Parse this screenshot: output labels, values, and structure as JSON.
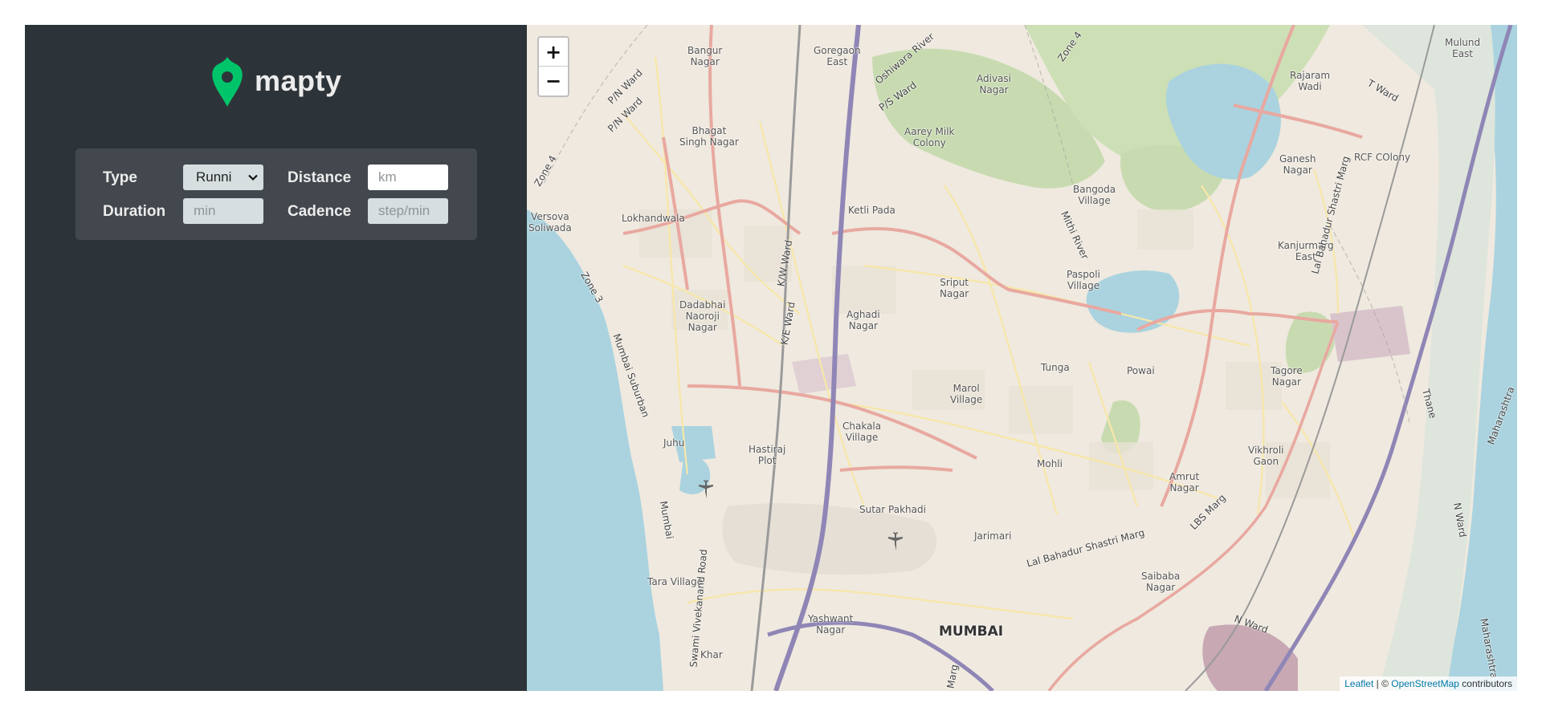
{
  "logo": {
    "text": "mapty",
    "icon": "map-pin-icon",
    "icon_color": "#00c46a"
  },
  "form": {
    "type_label": "Type",
    "type_value": "Runni",
    "distance_label": "Distance",
    "distance_placeholder": "km",
    "duration_label": "Duration",
    "duration_placeholder": "min",
    "cadence_label": "Cadence",
    "cadence_placeholder": "step/min"
  },
  "map": {
    "zoom_in": "+",
    "zoom_out": "−",
    "attribution": {
      "leaflet": "Leaflet",
      "separator": " | © ",
      "osm": "OpenStreetMap",
      "suffix": " contributors"
    },
    "places": [
      "Bangur\nNagar",
      "Goregaon\nEast",
      "Bhagat\nSingh Nagar",
      "Aarey Milk\nColony",
      "Adivasi\nNagar",
      "Rajaram\nWadi",
      "Mulund\nEast",
      "Ganesh\nNagar",
      "RCF COlony",
      "Bangoda\nVillage",
      "Ketli Pada",
      "Lokhandwala",
      "Versova\nSoliwada",
      "Sriput\nNagar",
      "Paspoli\nVillage",
      "Kanjurmarg\nEast",
      "Dadabhai\nNaoroji\nNagar",
      "Aghadi\nNagar",
      "Powai",
      "Tunga",
      "Tagore\nNagar",
      "Marol\nVillage",
      "Chakala\nVillage",
      "Hastiraj\nPlot",
      "Juhu",
      "Mohli",
      "Vikhroli\nGaon",
      "Amrut\nNagar",
      "Sutar Pakhadi",
      "Jarimari",
      "Saibaba\nNagar",
      "Tara Village",
      "Yashwant\nNagar",
      "MUMBAI",
      "Khar"
    ],
    "roads": [
      "P/N Ward",
      "P/S Ward",
      "Zone 4",
      "Zone 3",
      "Oshiwara River",
      "K/W Ward",
      "K/E Ward",
      "Mithi River",
      "Mumbai Suburban",
      "Mumbai",
      "Swami Vivekanand Road",
      "T Ward",
      "Lal Bahadur Shastri Marg",
      "LBS Marg",
      "N Ward",
      "Thane",
      "Maharashtra",
      "Marg"
    ]
  }
}
